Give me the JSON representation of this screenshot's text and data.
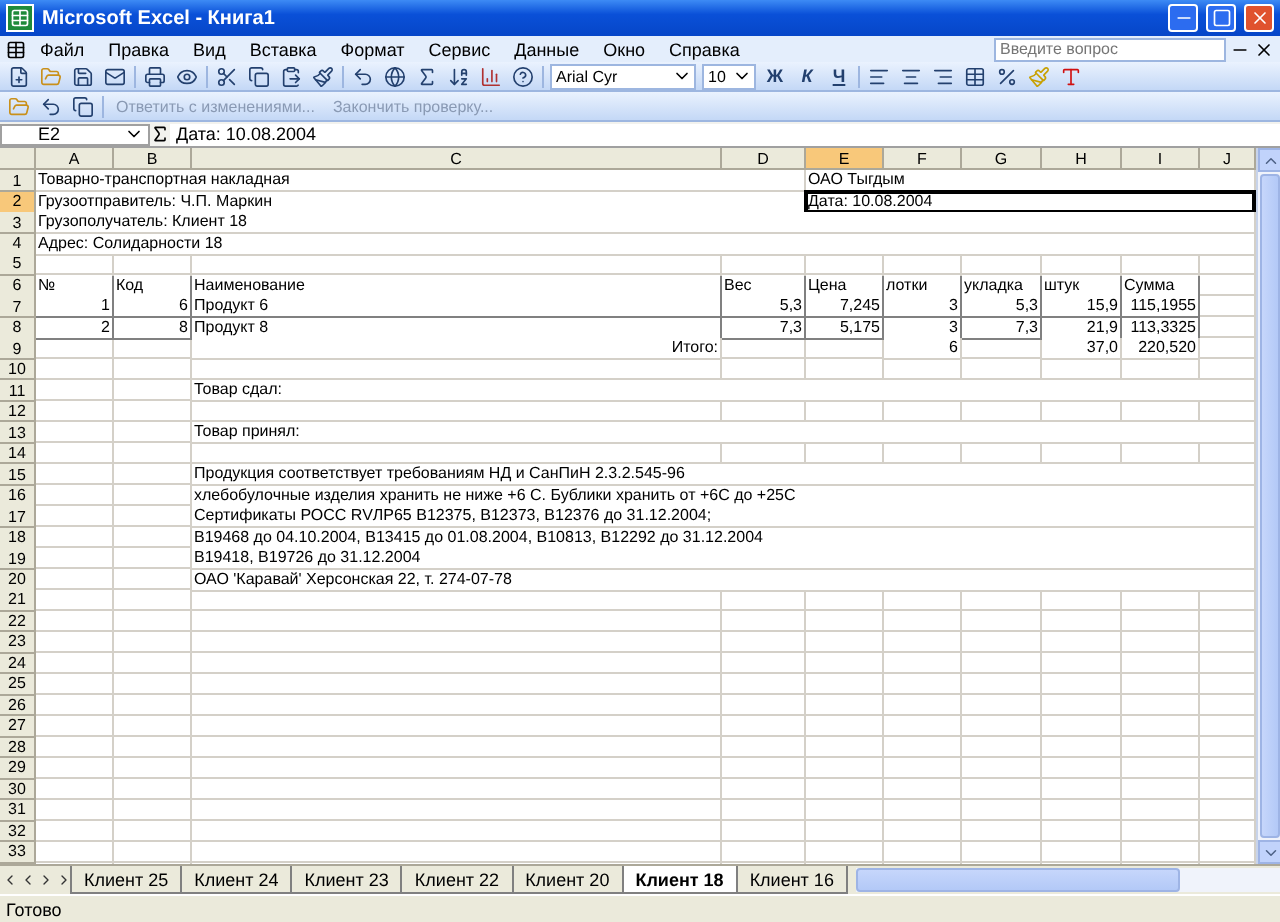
{
  "window": {
    "title": "Microsoft Excel - Книга1"
  },
  "menu": {
    "items": [
      "Файл",
      "Правка",
      "Вид",
      "Вставка",
      "Формат",
      "Сервис",
      "Данные",
      "Окно",
      "Справка"
    ],
    "help_placeholder": "Введите вопрос"
  },
  "formatting": {
    "font": "Arial Cyr",
    "size": "10",
    "styles": [
      "Ж",
      "К",
      "Ч"
    ]
  },
  "review_toolbar": {
    "actions": [
      {
        "label": "Ответить с изменениями...",
        "disabled": true
      },
      {
        "label": "Закончить проверку...",
        "disabled": true
      }
    ]
  },
  "formula_bar": {
    "name_box": "E2",
    "formula": "Дата: 10.08.2004"
  },
  "columns": [
    {
      "label": "A",
      "selected": false
    },
    {
      "label": "B",
      "selected": false
    },
    {
      "label": "C",
      "selected": false
    },
    {
      "label": "D",
      "selected": false
    },
    {
      "label": "E",
      "selected": true
    },
    {
      "label": "F",
      "selected": false
    },
    {
      "label": "G",
      "selected": false
    },
    {
      "label": "H",
      "selected": false
    },
    {
      "label": "I",
      "selected": false
    },
    {
      "label": "J",
      "selected": false
    }
  ],
  "rows": [
    {
      "number": "1",
      "selected": false,
      "cells": {
        "A": {
          "text": "Товарно-транспортная накладная",
          "kind": "text"
        },
        "E": {
          "text": "ОАО Тыгдым",
          "kind": "text"
        }
      }
    },
    {
      "number": "2",
      "selected": true,
      "cells": {
        "A": {
          "text": "Грузоотправитель: Ч.П. Маркин",
          "kind": "text"
        },
        "E": {
          "text": "Дата: 10.08.2004",
          "kind": "text",
          "active": true
        }
      }
    },
    {
      "number": "3",
      "selected": false,
      "cells": {
        "A": {
          "text": "Грузополучатель: Клиент 18",
          "kind": "text"
        }
      }
    },
    {
      "number": "4",
      "selected": false,
      "cells": {
        "A": {
          "text": "Адрес: Солидарности 18",
          "kind": "text"
        }
      }
    },
    {
      "number": "5",
      "selected": false
    },
    {
      "number": "6",
      "selected": false,
      "table": true,
      "cells": {
        "A": {
          "text": "№",
          "kind": "text"
        },
        "B": {
          "text": "Код",
          "kind": "text"
        },
        "C": {
          "text": "Наименование",
          "kind": "text"
        },
        "D": {
          "text": "Вес",
          "kind": "text"
        },
        "E": {
          "text": "Цена",
          "kind": "text"
        },
        "F": {
          "text": "лотки",
          "kind": "text"
        },
        "G": {
          "text": "укладка",
          "kind": "text"
        },
        "H": {
          "text": "штук",
          "kind": "text"
        },
        "I": {
          "text": "Сумма",
          "kind": "text"
        }
      }
    },
    {
      "number": "7",
      "selected": false,
      "table": true,
      "cells": {
        "A": {
          "text": "1",
          "kind": "number"
        },
        "B": {
          "text": "6",
          "kind": "number"
        },
        "C": {
          "text": "Продукт 6",
          "kind": "text"
        },
        "D": {
          "text": "5,3",
          "kind": "number"
        },
        "E": {
          "text": "7,245",
          "kind": "number"
        },
        "F": {
          "text": "3",
          "kind": "number"
        },
        "G": {
          "text": "5,3",
          "kind": "number"
        },
        "H": {
          "text": "15,9",
          "kind": "number"
        },
        "I": {
          "text": "115,1955",
          "kind": "number"
        }
      }
    },
    {
      "number": "8",
      "selected": false,
      "table": true,
      "cells": {
        "A": {
          "text": "2",
          "kind": "number"
        },
        "B": {
          "text": "8",
          "kind": "number"
        },
        "C": {
          "text": "Продукт 8",
          "kind": "text"
        },
        "D": {
          "text": "7,3",
          "kind": "number"
        },
        "E": {
          "text": "5,175",
          "kind": "number"
        },
        "F": {
          "text": "3",
          "kind": "number"
        },
        "G": {
          "text": "7,3",
          "kind": "number"
        },
        "H": {
          "text": "21,9",
          "kind": "number"
        },
        "I": {
          "text": "113,3325",
          "kind": "number"
        }
      }
    },
    {
      "number": "9",
      "selected": false,
      "cells": {
        "C": {
          "text": "Итого:",
          "kind": "total"
        },
        "F": {
          "text": "6",
          "kind": "number"
        },
        "H": {
          "text": "37,0",
          "kind": "number"
        },
        "I": {
          "text": "220,520",
          "kind": "number"
        }
      }
    },
    {
      "number": "10",
      "selected": false
    },
    {
      "number": "11",
      "selected": false,
      "cells": {
        "C": {
          "text": "Товар сдал:",
          "kind": "text"
        }
      }
    },
    {
      "number": "12",
      "selected": false
    },
    {
      "number": "13",
      "selected": false,
      "cells": {
        "C": {
          "text": "Товар принял:",
          "kind": "text"
        }
      }
    },
    {
      "number": "14",
      "selected": false
    },
    {
      "number": "15",
      "selected": false,
      "cells": {
        "C": {
          "text": "Продукция соответствует требованиям НД и СанПиН 2.3.2.545-96",
          "kind": "text"
        }
      }
    },
    {
      "number": "16",
      "selected": false,
      "cells": {
        "C": {
          "text": "хлебобулочные изделия хранить не ниже +6 С. Бублики хранить от +6С до +25С",
          "kind": "text"
        }
      }
    },
    {
      "number": "17",
      "selected": false,
      "cells": {
        "C": {
          "text": "Сертификаты РОСС RVЛР65 B12375, B12373, B12376 до 31.12.2004;",
          "kind": "text"
        }
      }
    },
    {
      "number": "18",
      "selected": false,
      "cells": {
        "C": {
          "text": "B19468 до 04.10.2004, B13415 до 01.08.2004, B10813, B12292 до 31.12.2004",
          "kind": "text"
        }
      }
    },
    {
      "number": "19",
      "selected": false,
      "cells": {
        "C": {
          "text": "B19418, B19726 до 31.12.2004",
          "kind": "text"
        }
      }
    },
    {
      "number": "20",
      "selected": false,
      "cells": {
        "C": {
          "text": "ОАО 'Каравай' Херсонская 22, т. 274-07-78",
          "kind": "text"
        }
      }
    },
    {
      "number": "21",
      "selected": false
    },
    {
      "number": "22",
      "selected": false
    },
    {
      "number": "23",
      "selected": false
    },
    {
      "number": "24",
      "selected": false
    },
    {
      "number": "25",
      "selected": false
    },
    {
      "number": "26",
      "selected": false
    },
    {
      "number": "27",
      "selected": false
    },
    {
      "number": "28",
      "selected": false
    },
    {
      "number": "29",
      "selected": false
    },
    {
      "number": "30",
      "selected": false
    },
    {
      "number": "31",
      "selected": false
    },
    {
      "number": "32",
      "selected": false
    },
    {
      "number": "33",
      "selected": false
    }
  ],
  "sheet_tabs": [
    {
      "label": "Клиент 25",
      "selected": false
    },
    {
      "label": "Клиент 24",
      "selected": false
    },
    {
      "label": "Клиент 23",
      "selected": false
    },
    {
      "label": "Клиент 22",
      "selected": false
    },
    {
      "label": "Клиент 20",
      "selected": false
    },
    {
      "label": "Клиент 18",
      "selected": true
    },
    {
      "label": "Клиент 16",
      "selected": false
    }
  ],
  "status_bar": {
    "text": "Готово"
  }
}
